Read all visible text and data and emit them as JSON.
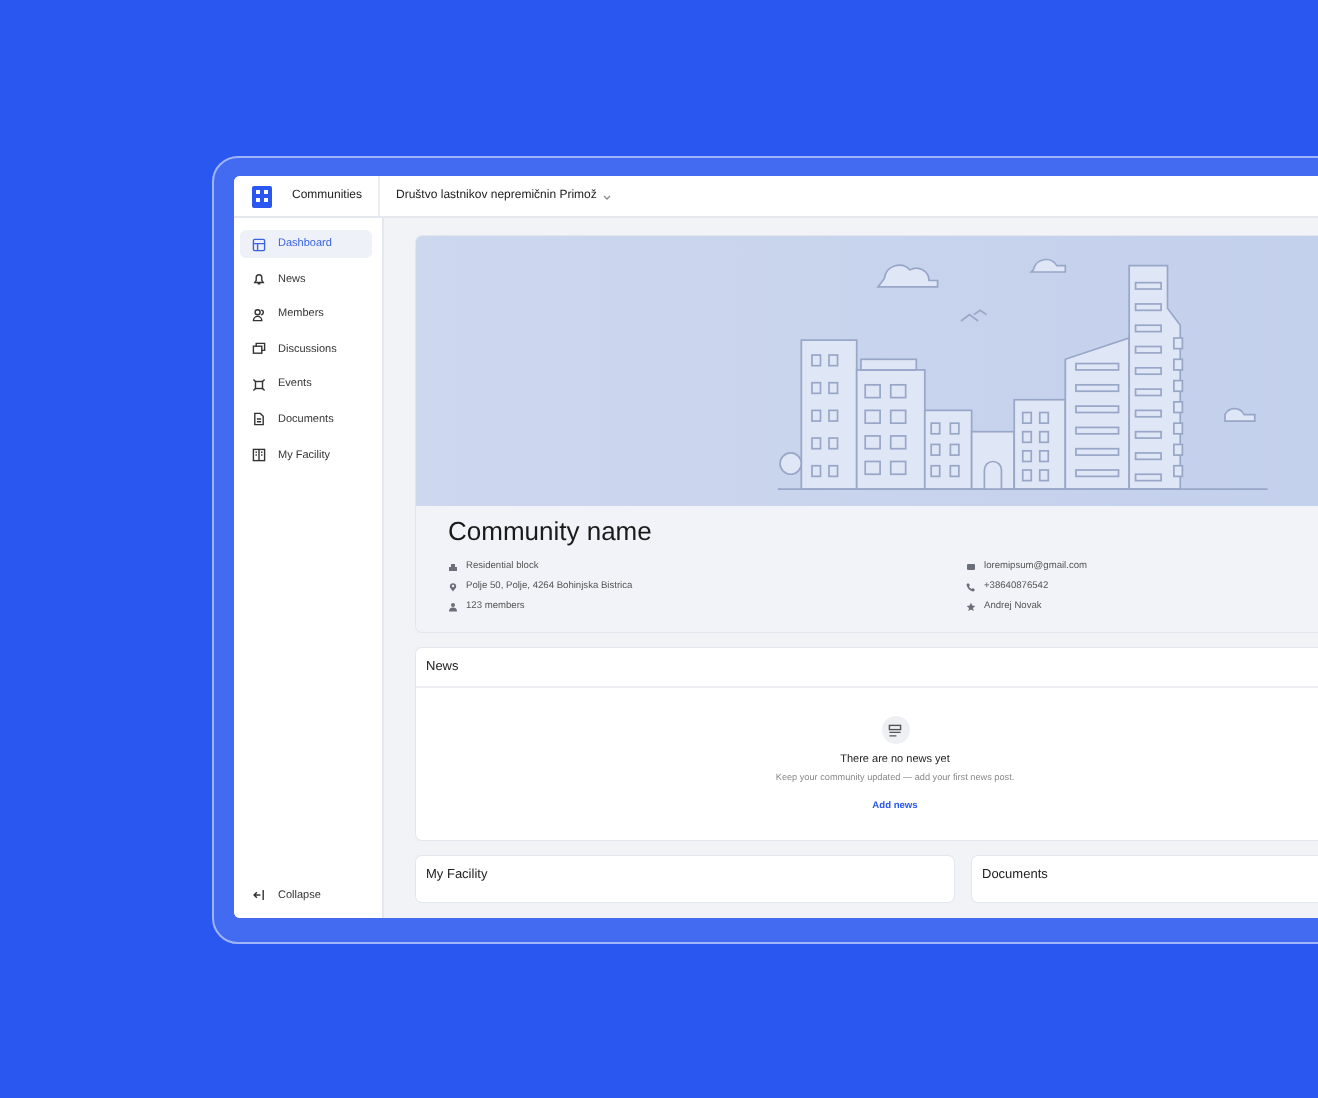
{
  "header": {
    "section": "Communities",
    "community": "Društvo lastnikov nepremičnin Primož"
  },
  "sidebar": {
    "items": [
      {
        "label": "Dashboard",
        "selected": true,
        "kind": "dashboard"
      },
      {
        "label": "News",
        "selected": false,
        "kind": "bell"
      },
      {
        "label": "Members",
        "selected": false,
        "kind": "people"
      },
      {
        "label": "Discussions",
        "selected": false,
        "kind": "chat"
      },
      {
        "label": "Events",
        "selected": false,
        "kind": "event"
      },
      {
        "label": "Documents",
        "selected": false,
        "kind": "document"
      },
      {
        "label": "My Facility",
        "selected": false,
        "kind": "facility"
      }
    ],
    "collapse": "Collapse"
  },
  "community": {
    "name": "Community name",
    "details": [
      {
        "kind": "building",
        "text": "Residential block"
      },
      {
        "kind": "pin",
        "text": "Polje 50, Polje, 4264 Bohinjska Bistrica"
      },
      {
        "kind": "person",
        "text": "123 members"
      }
    ],
    "contacts": [
      {
        "kind": "mail",
        "text": "loremipsum@gmail.com"
      },
      {
        "kind": "phone",
        "text": "+38640876542"
      },
      {
        "kind": "star",
        "text": "Andrej Novak"
      }
    ]
  },
  "news": {
    "title": "News",
    "empty_title": "There are no news yet",
    "empty_text": "Keep your community updated — add your first news post.",
    "action": "Add news"
  },
  "cards": [
    {
      "title": "My Facility"
    },
    {
      "title": "Documents"
    }
  ]
}
